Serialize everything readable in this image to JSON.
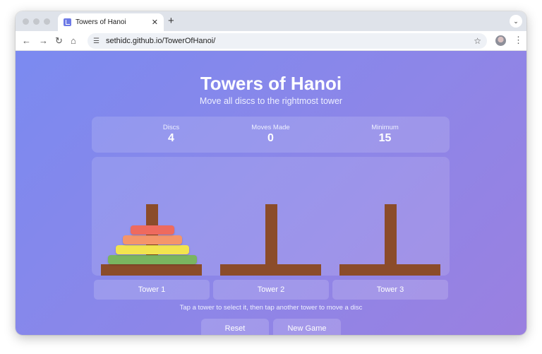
{
  "browser": {
    "tab_title": "Towers of Hanoi",
    "tab_close": "✕",
    "new_tab": "+",
    "tab_menu": "⌄",
    "back": "←",
    "forward": "→",
    "reload": "↻",
    "home": "⌂",
    "tune": "☰",
    "url": "sethidc.github.io/TowerOfHanoi/",
    "star": "☆",
    "kebab": "⋮"
  },
  "header": {
    "title": "Towers of Hanoi",
    "subtitle": "Move all discs to the rightmost tower"
  },
  "stats": {
    "discs_label": "Discs",
    "discs_value": "4",
    "moves_label": "Moves Made",
    "moves_value": "0",
    "minimum_label": "Minimum",
    "minimum_value": "15"
  },
  "board": {
    "towers": [
      {
        "label": "Tower 1",
        "discs": [
          {
            "size": 4,
            "color": "#7ab560"
          },
          {
            "size": 3,
            "color": "#f2e44f"
          },
          {
            "size": 2,
            "color": "#f4956b"
          },
          {
            "size": 1,
            "color": "#ee6a5e"
          }
        ]
      },
      {
        "label": "Tower 2",
        "discs": []
      },
      {
        "label": "Tower 3",
        "discs": []
      }
    ],
    "peg_color": "#8b4c2a"
  },
  "hint": "Tap a tower to select it, then tap another tower to move a disc",
  "actions": {
    "reset_label": "Reset",
    "new_game_label": "New Game"
  }
}
